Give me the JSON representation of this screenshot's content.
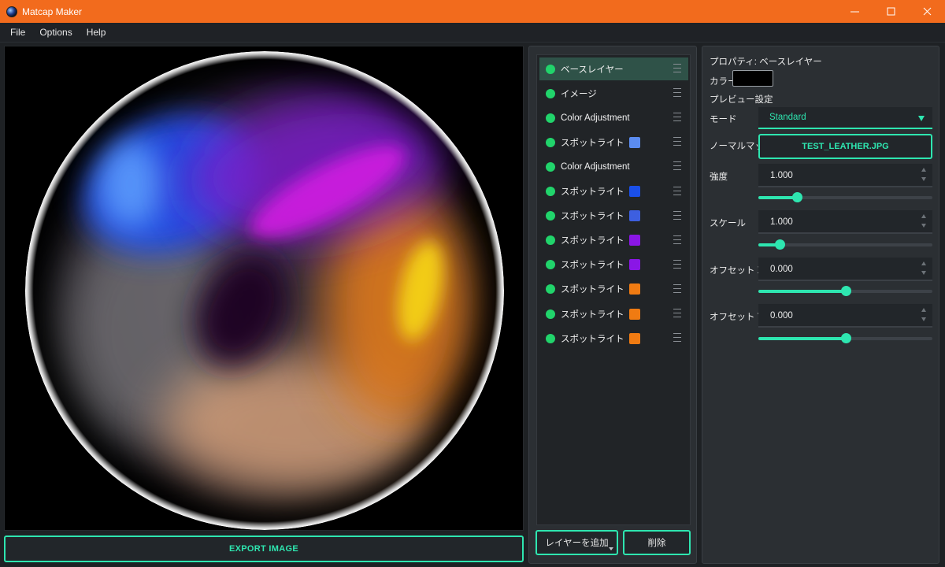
{
  "window": {
    "title": "Matcap Maker",
    "icon": "matcap-sphere-icon",
    "controls": [
      "minimize-icon",
      "maximize-icon",
      "close-icon"
    ]
  },
  "menu": [
    "File",
    "Options",
    "Help"
  ],
  "preview": {
    "export_label": "EXPORT IMAGE"
  },
  "layers": {
    "items": [
      {
        "label": "ベースレイヤー",
        "selected": true,
        "swatch": null
      },
      {
        "label": "イメージ",
        "selected": false,
        "swatch": null
      },
      {
        "label": "Color Adjustment",
        "selected": false,
        "swatch": null
      },
      {
        "label": "スポットライト",
        "selected": false,
        "swatch": "#5b8cf0"
      },
      {
        "label": "Color Adjustment",
        "selected": false,
        "swatch": null
      },
      {
        "label": "スポットライト",
        "selected": false,
        "swatch": "#1a4fe8"
      },
      {
        "label": "スポットライト",
        "selected": false,
        "swatch": "#3d5fe0"
      },
      {
        "label": "スポットライト",
        "selected": false,
        "swatch": "#8a16e6"
      },
      {
        "label": "スポットライト",
        "selected": false,
        "swatch": "#8a16e6"
      },
      {
        "label": "スポットライト",
        "selected": false,
        "swatch": "#f07b12"
      },
      {
        "label": "スポットライト",
        "selected": false,
        "swatch": "#f07b12"
      },
      {
        "label": "スポットライト",
        "selected": false,
        "swatch": "#f07b12"
      }
    ],
    "add_label": "レイヤーを追加",
    "delete_label": "削除"
  },
  "properties": {
    "header": "プロパティ: ベースレイヤー",
    "color_label": "カラー",
    "color_value": "#000000",
    "preview_settings_label": "プレビュー設定",
    "mode_label": "モード",
    "mode_value": "Standard",
    "normal_map_label": "ノーマルマップ",
    "normal_map_file": "TEST_LEATHER.JPG",
    "strength_label": "強度",
    "strength_value": "1.000",
    "strength_slider": 0.22,
    "scale_label": "スケール",
    "scale_value": "1.000",
    "scale_slider": 0.12,
    "offset_x_label": "オフセット X",
    "offset_x_value": "0.000",
    "offset_x_slider": 0.5,
    "offset_y_label": "オフセット Y",
    "offset_y_value": "0.000",
    "offset_y_slider": 0.5
  },
  "colors": {
    "title_bar": "#f26b1d",
    "accent": "#2ee6b0",
    "layer_dot": "#21d46b",
    "panel_bg": "#2b2f33"
  }
}
